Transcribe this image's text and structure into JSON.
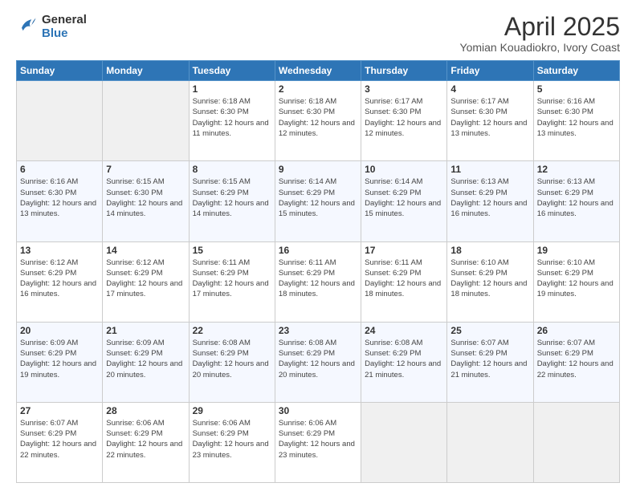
{
  "logo": {
    "line1": "General",
    "line2": "Blue"
  },
  "title": "April 2025",
  "subtitle": "Yomian Kouadiokro, Ivory Coast",
  "days_of_week": [
    "Sunday",
    "Monday",
    "Tuesday",
    "Wednesday",
    "Thursday",
    "Friday",
    "Saturday"
  ],
  "weeks": [
    [
      {
        "day": "",
        "info": ""
      },
      {
        "day": "",
        "info": ""
      },
      {
        "day": "1",
        "info": "Sunrise: 6:18 AM\nSunset: 6:30 PM\nDaylight: 12 hours and 11 minutes."
      },
      {
        "day": "2",
        "info": "Sunrise: 6:18 AM\nSunset: 6:30 PM\nDaylight: 12 hours and 12 minutes."
      },
      {
        "day": "3",
        "info": "Sunrise: 6:17 AM\nSunset: 6:30 PM\nDaylight: 12 hours and 12 minutes."
      },
      {
        "day": "4",
        "info": "Sunrise: 6:17 AM\nSunset: 6:30 PM\nDaylight: 12 hours and 13 minutes."
      },
      {
        "day": "5",
        "info": "Sunrise: 6:16 AM\nSunset: 6:30 PM\nDaylight: 12 hours and 13 minutes."
      }
    ],
    [
      {
        "day": "6",
        "info": "Sunrise: 6:16 AM\nSunset: 6:30 PM\nDaylight: 12 hours and 13 minutes."
      },
      {
        "day": "7",
        "info": "Sunrise: 6:15 AM\nSunset: 6:30 PM\nDaylight: 12 hours and 14 minutes."
      },
      {
        "day": "8",
        "info": "Sunrise: 6:15 AM\nSunset: 6:29 PM\nDaylight: 12 hours and 14 minutes."
      },
      {
        "day": "9",
        "info": "Sunrise: 6:14 AM\nSunset: 6:29 PM\nDaylight: 12 hours and 15 minutes."
      },
      {
        "day": "10",
        "info": "Sunrise: 6:14 AM\nSunset: 6:29 PM\nDaylight: 12 hours and 15 minutes."
      },
      {
        "day": "11",
        "info": "Sunrise: 6:13 AM\nSunset: 6:29 PM\nDaylight: 12 hours and 16 minutes."
      },
      {
        "day": "12",
        "info": "Sunrise: 6:13 AM\nSunset: 6:29 PM\nDaylight: 12 hours and 16 minutes."
      }
    ],
    [
      {
        "day": "13",
        "info": "Sunrise: 6:12 AM\nSunset: 6:29 PM\nDaylight: 12 hours and 16 minutes."
      },
      {
        "day": "14",
        "info": "Sunrise: 6:12 AM\nSunset: 6:29 PM\nDaylight: 12 hours and 17 minutes."
      },
      {
        "day": "15",
        "info": "Sunrise: 6:11 AM\nSunset: 6:29 PM\nDaylight: 12 hours and 17 minutes."
      },
      {
        "day": "16",
        "info": "Sunrise: 6:11 AM\nSunset: 6:29 PM\nDaylight: 12 hours and 18 minutes."
      },
      {
        "day": "17",
        "info": "Sunrise: 6:11 AM\nSunset: 6:29 PM\nDaylight: 12 hours and 18 minutes."
      },
      {
        "day": "18",
        "info": "Sunrise: 6:10 AM\nSunset: 6:29 PM\nDaylight: 12 hours and 18 minutes."
      },
      {
        "day": "19",
        "info": "Sunrise: 6:10 AM\nSunset: 6:29 PM\nDaylight: 12 hours and 19 minutes."
      }
    ],
    [
      {
        "day": "20",
        "info": "Sunrise: 6:09 AM\nSunset: 6:29 PM\nDaylight: 12 hours and 19 minutes."
      },
      {
        "day": "21",
        "info": "Sunrise: 6:09 AM\nSunset: 6:29 PM\nDaylight: 12 hours and 20 minutes."
      },
      {
        "day": "22",
        "info": "Sunrise: 6:08 AM\nSunset: 6:29 PM\nDaylight: 12 hours and 20 minutes."
      },
      {
        "day": "23",
        "info": "Sunrise: 6:08 AM\nSunset: 6:29 PM\nDaylight: 12 hours and 20 minutes."
      },
      {
        "day": "24",
        "info": "Sunrise: 6:08 AM\nSunset: 6:29 PM\nDaylight: 12 hours and 21 minutes."
      },
      {
        "day": "25",
        "info": "Sunrise: 6:07 AM\nSunset: 6:29 PM\nDaylight: 12 hours and 21 minutes."
      },
      {
        "day": "26",
        "info": "Sunrise: 6:07 AM\nSunset: 6:29 PM\nDaylight: 12 hours and 22 minutes."
      }
    ],
    [
      {
        "day": "27",
        "info": "Sunrise: 6:07 AM\nSunset: 6:29 PM\nDaylight: 12 hours and 22 minutes."
      },
      {
        "day": "28",
        "info": "Sunrise: 6:06 AM\nSunset: 6:29 PM\nDaylight: 12 hours and 22 minutes."
      },
      {
        "day": "29",
        "info": "Sunrise: 6:06 AM\nSunset: 6:29 PM\nDaylight: 12 hours and 23 minutes."
      },
      {
        "day": "30",
        "info": "Sunrise: 6:06 AM\nSunset: 6:29 PM\nDaylight: 12 hours and 23 minutes."
      },
      {
        "day": "",
        "info": ""
      },
      {
        "day": "",
        "info": ""
      },
      {
        "day": "",
        "info": ""
      }
    ]
  ]
}
